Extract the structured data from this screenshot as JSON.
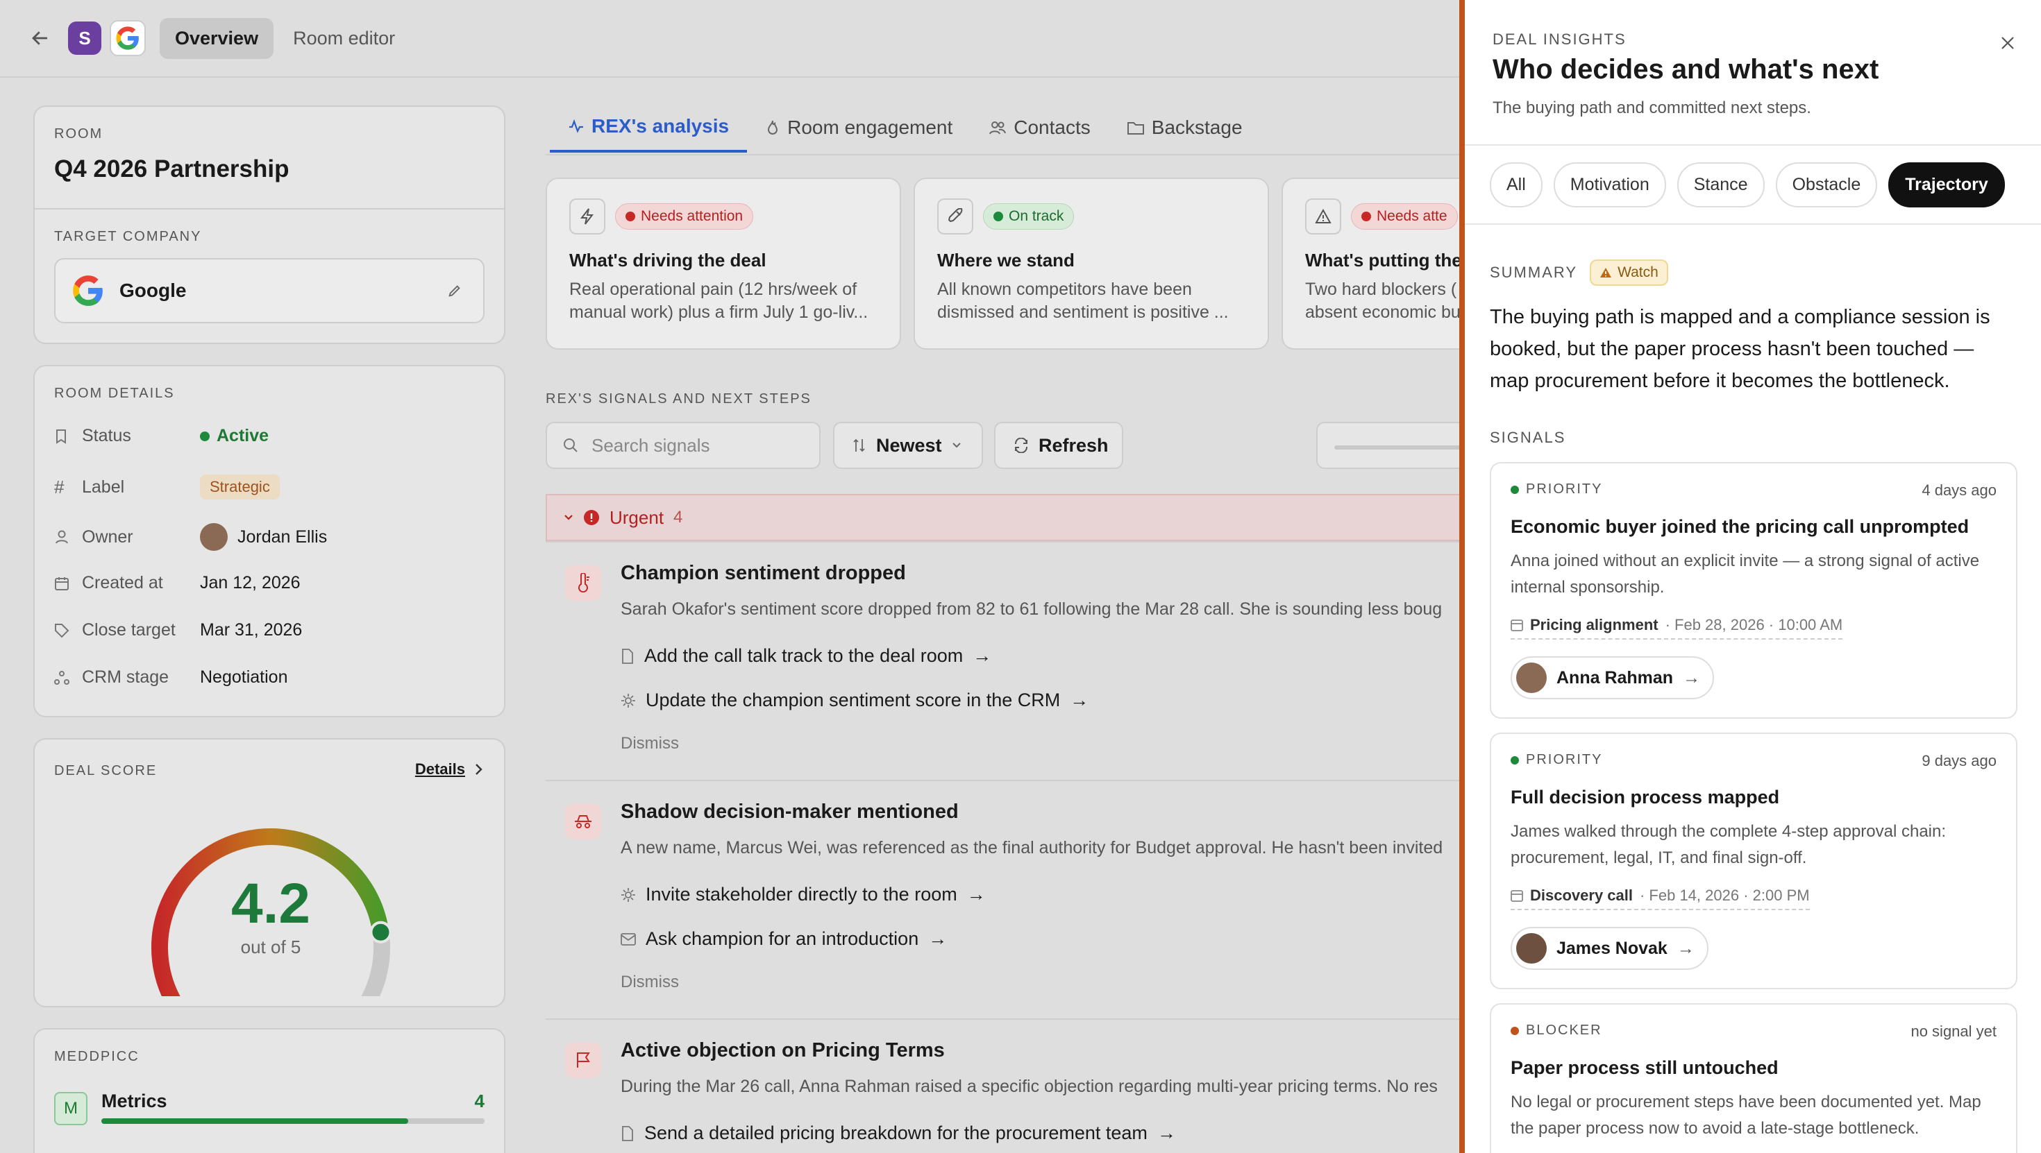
{
  "topbar": {
    "tabs": [
      "Overview",
      "Room editor"
    ],
    "workspace_initial": "S"
  },
  "room": {
    "caption": "ROOM",
    "name": "Q4 2026 Partnership",
    "company_caption": "TARGET COMPANY",
    "company": "Google"
  },
  "details": {
    "caption": "ROOM DETAILS",
    "status_label": "Status",
    "status_value": "Active",
    "label_label": "Label",
    "label_value": "Strategic",
    "owner_label": "Owner",
    "owner_value": "Jordan Ellis",
    "created_label": "Created at",
    "created_value": "Jan 12, 2026",
    "close_label": "Close target",
    "close_value": "Mar 31, 2026",
    "crm_label": "CRM stage",
    "crm_value": "Negotiation"
  },
  "deal_score": {
    "caption": "DEAL SCORE",
    "details_link": "Details",
    "score": "4.2",
    "score_value": 4.2,
    "max": 5,
    "out_of": "out of 5"
  },
  "meddpicc": {
    "caption": "MEDDPICC",
    "letter": "M",
    "name": "Metrics",
    "value": "4",
    "progress": 0.8
  },
  "tabs": [
    "REX's analysis",
    "Room engagement",
    "Contacts",
    "Backstage"
  ],
  "insights": [
    {
      "badge": "Needs attention",
      "title": "What's driving the deal",
      "desc1": "Real operational pain (12 hrs/week of",
      "desc2": "manual work) plus a firm July 1 go-liv..."
    },
    {
      "badge": "On track",
      "title": "Where we stand",
      "desc1": "All known competitors have been",
      "desc2": "dismissed and sentiment is positive ..."
    },
    {
      "badge": "Needs atte",
      "title": "What's putting the",
      "desc1": "Two hard blockers (",
      "desc2": "absent economic bu"
    }
  ],
  "signals_section": {
    "caption": "REX'S SIGNALS AND NEXT STEPS",
    "search_placeholder": "Search signals",
    "sort": "Newest",
    "refresh": "Refresh"
  },
  "urgent": {
    "label": "Urgent",
    "count": "4"
  },
  "signals": [
    {
      "title": "Champion sentiment dropped",
      "desc": "Sarah Okafor's sentiment score dropped from 82 to 61 following the Mar 28 call. She is sounding less boug",
      "actions": [
        "Add the call talk track to the deal room",
        "Update the champion sentiment score in the CRM"
      ],
      "dismiss": "Dismiss"
    },
    {
      "title": "Shadow decision-maker mentioned",
      "desc": "A new name, Marcus Wei, was referenced as the final authority for Budget approval. He hasn't been invited",
      "actions": [
        "Invite stakeholder directly to the room",
        "Ask champion for an introduction"
      ],
      "dismiss": "Dismiss"
    },
    {
      "title": "Active objection on Pricing Terms",
      "desc": "During the Mar 26 call, Anna Rahman raised a specific objection regarding multi-year pricing terms. No res",
      "actions": [
        "Send a detailed pricing breakdown for the procurement team"
      ]
    }
  ],
  "panel": {
    "caption": "DEAL INSIGHTS",
    "title": "Who decides and what's next",
    "subtitle": "The buying path and committed next steps.",
    "filters": [
      "All",
      "Motivation",
      "Stance",
      "Obstacle",
      "Trajectory"
    ],
    "summary_caption": "SUMMARY",
    "summary_badge": "Watch",
    "summary": "The buying path is mapped and a compliance session is booked, but the paper process hasn't been touched — map procurement before it becomes the bottleneck.",
    "signals_caption": "SIGNALS",
    "cards": [
      {
        "kind": "PRIORITY",
        "ago": "4 days ago",
        "title": "Economic buyer joined the pricing call unprompted",
        "body": "Anna joined without an explicit invite — a strong signal of active internal sponsorship.",
        "meeting": "Pricing alignment",
        "meeting_date": "· Feb 28, 2026 · 10:00 AM",
        "person": "Anna Rahman"
      },
      {
        "kind": "PRIORITY",
        "ago": "9 days ago",
        "title": "Full decision process mapped",
        "body": "James walked through the complete 4-step approval chain: procurement, legal, IT, and final sign-off.",
        "meeting": "Discovery call",
        "meeting_date": "· Feb 14, 2026 · 2:00 PM",
        "person": "James Novak"
      },
      {
        "kind": "BLOCKER",
        "ago": "no signal yet",
        "title": "Paper process still untouched",
        "body": "No legal or procurement steps have been documented yet. Map the paper process now to avoid a late-stage bottleneck."
      }
    ]
  },
  "colors": {
    "accent": "#2b5cc9",
    "urgent": "#b42020",
    "panel_edge": "#c0521a",
    "green": "#1c7a34"
  }
}
